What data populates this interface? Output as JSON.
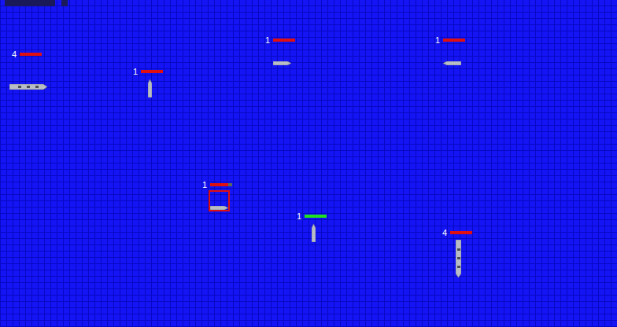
{
  "ships": [
    {
      "label": "4",
      "level": 1,
      "color": "#e01010",
      "selected": false,
      "kind": "large"
    },
    {
      "label": "1",
      "level": 1,
      "color": "#e01010",
      "selected": false,
      "kind": "small"
    },
    {
      "label": "1",
      "level": 1,
      "color": "#e01010",
      "selected": false,
      "kind": "small"
    },
    {
      "label": "1",
      "level": 1,
      "color": "#e01010",
      "selected": false,
      "kind": "small"
    },
    {
      "label": "1",
      "level": 0.8,
      "color": "#e01010",
      "selected": true,
      "kind": "small"
    },
    {
      "label": "1",
      "level": 1,
      "color": "#20e020",
      "selected": false,
      "kind": "small"
    },
    {
      "label": "4",
      "level": 1,
      "color": "#e01010",
      "selected": false,
      "kind": "large"
    }
  ]
}
